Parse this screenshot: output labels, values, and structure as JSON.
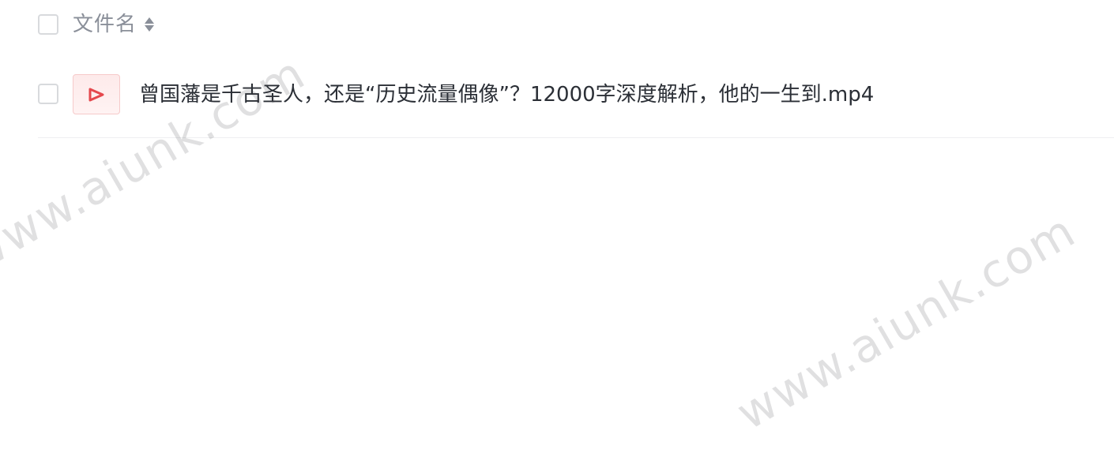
{
  "table_header": {
    "column_title": "文件名",
    "sort_icon": "sort-icon"
  },
  "rows": [
    {
      "file_type_icon": "video-play-icon",
      "name": "曾国藩是千古圣人，还是“历史流量偶像”？12000字深度解析，他的一生到.mp4"
    }
  ],
  "watermarks": [
    "www.aiunk.com",
    "www.aiunk.com"
  ],
  "colors": {
    "header_text": "#8a8f99",
    "file_text": "#2b2f36",
    "video_icon": "#e5484d",
    "checkbox_border": "#d8dadd"
  }
}
